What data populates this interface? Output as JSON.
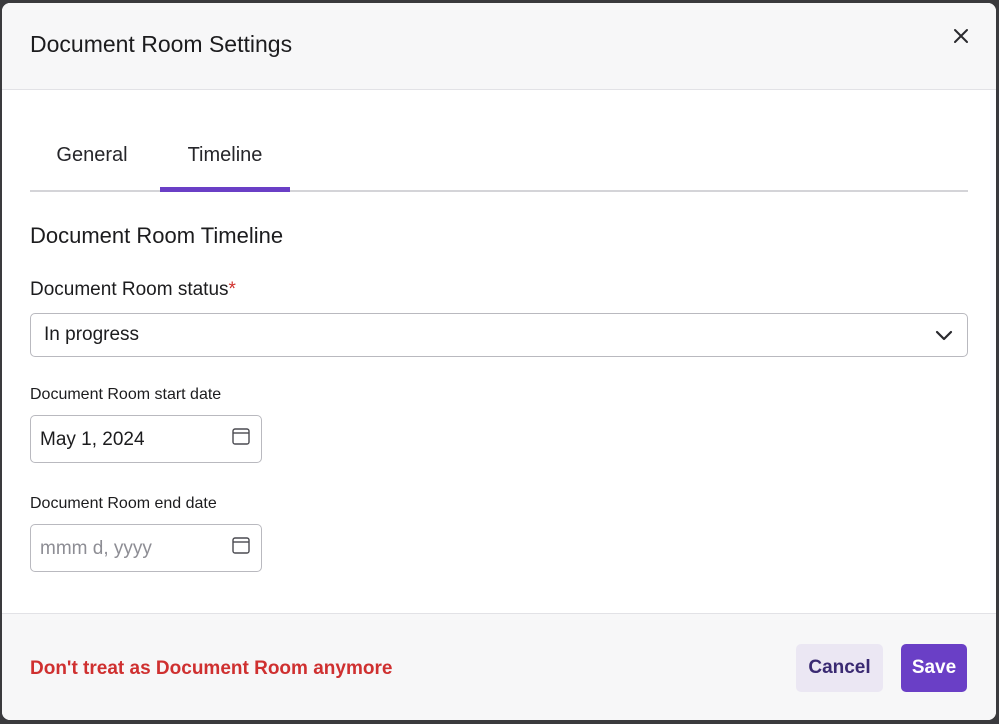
{
  "modal": {
    "title": "Document Room Settings"
  },
  "tabs": [
    {
      "label": "General",
      "active": false
    },
    {
      "label": "Timeline",
      "active": true
    }
  ],
  "section": {
    "title": "Document Room Timeline"
  },
  "status_field": {
    "label": "Document Room status",
    "required_marker": "*",
    "value": "In progress"
  },
  "start_date_field": {
    "label": "Document Room start date",
    "value": "May 1, 2024"
  },
  "end_date_field": {
    "label": "Document Room end date",
    "placeholder": "mmm d, yyyy"
  },
  "footer": {
    "danger_link": "Don't treat as Document Room anymore",
    "cancel_label": "Cancel",
    "save_label": "Save"
  },
  "colors": {
    "accent": "#6a3fc6",
    "danger": "#cf3030",
    "cancel_bg": "#ebe7f3"
  },
  "icons": {
    "close": "close-icon",
    "chevron": "chevron-down-icon",
    "calendar": "calendar-icon"
  }
}
